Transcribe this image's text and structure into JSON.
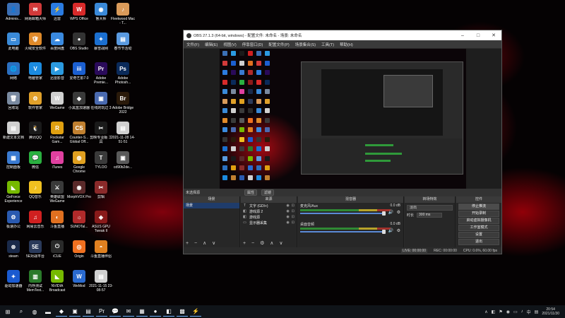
{
  "desktop": {
    "icons": [
      {
        "label": "Adminis...",
        "glyph": "👤",
        "color": "#3b6fb5",
        "col": 0,
        "row": 0
      },
      {
        "label": "网易邮箱大师",
        "glyph": "✉",
        "color": "#d23a3a",
        "col": 1,
        "row": 0
      },
      {
        "label": "迅雷",
        "glyph": "⚡",
        "color": "#2b7be0",
        "col": 2,
        "row": 0
      },
      {
        "label": "WPS Office",
        "glyph": "W",
        "color": "#d82a2a",
        "col": 3,
        "row": 0
      },
      {
        "label": "鲁大师",
        "glyph": "◉",
        "color": "#3a89d8",
        "col": 4,
        "row": 0
      },
      {
        "label": "Fleetwood Mac - T...",
        "glyph": "♪",
        "color": "#d99a5a",
        "col": 5,
        "row": 0
      },
      {
        "label": "此电脑",
        "glyph": "▭",
        "color": "#3a8ad8",
        "col": 0,
        "row": 1
      },
      {
        "label": "火绒安全软件",
        "glyph": "🛡",
        "color": "#e08a2a",
        "col": 1,
        "row": 1
      },
      {
        "label": "百度网盘",
        "glyph": "☁",
        "color": "#3a8ae0",
        "col": 2,
        "row": 1
      },
      {
        "label": "OBS Studio",
        "glyph": "●",
        "color": "#333333",
        "col": 3,
        "row": 1
      },
      {
        "label": "暴雪战网",
        "glyph": "✦",
        "color": "#1b6fd0",
        "col": 4,
        "row": 1
      },
      {
        "label": "春节节活动",
        "glyph": "▤",
        "color": "#5a9ae0",
        "col": 5,
        "row": 1
      },
      {
        "label": "网络",
        "glyph": "🌐",
        "color": "#2b6fc0",
        "col": 0,
        "row": 2
      },
      {
        "label": "电脑管家",
        "glyph": "V",
        "color": "#1b8be0",
        "col": 1,
        "row": 2
      },
      {
        "label": "迅雷影音",
        "glyph": "▶",
        "color": "#2b9ae0",
        "col": 2,
        "row": 2
      },
      {
        "label": "爱奇艺影7.0",
        "glyph": "iii",
        "color": "#1b5fd0",
        "col": 3,
        "row": 2
      },
      {
        "label": "Adobe Premie...",
        "glyph": "Pr",
        "color": "#2a0a5a",
        "col": 4,
        "row": 2
      },
      {
        "label": "Adobe Photosh...",
        "glyph": "Ps",
        "color": "#0a2a5a",
        "col": 5,
        "row": 2
      },
      {
        "label": "回收站",
        "glyph": "🗑",
        "color": "#7a8aa0",
        "col": 0,
        "row": 3
      },
      {
        "label": "软件管家",
        "glyph": "⚙",
        "color": "#e0a02a",
        "col": 1,
        "row": 3
      },
      {
        "label": "WeGame",
        "glyph": "W",
        "color": "#d0d0d0",
        "col": 2,
        "row": 3
      },
      {
        "label": "小黑盒加速器",
        "glyph": "◆",
        "color": "#3a3a3a",
        "col": 3,
        "row": 3
      },
      {
        "label": "在线的玩过 3",
        "glyph": "▣",
        "color": "#4a6ab0",
        "col": 4,
        "row": 3
      },
      {
        "label": "Adobe Bridge 2022",
        "glyph": "Br",
        "color": "#2a1a0a",
        "col": 5,
        "row": 3
      },
      {
        "label": "新建文本文档",
        "glyph": "▤",
        "color": "#d0d0d0",
        "col": 0,
        "row": 4
      },
      {
        "label": "腾讯QQ",
        "glyph": "🐧",
        "color": "#1a1a1a",
        "col": 1,
        "row": 4
      },
      {
        "label": "Rockstar Gam...",
        "glyph": "R",
        "color": "#e0a010",
        "col": 2,
        "row": 4
      },
      {
        "label": "Counter-S... Global Off...",
        "glyph": "CS",
        "color": "#c08030",
        "col": 3,
        "row": 4
      },
      {
        "label": "剪映专业版 工具",
        "glyph": "✂",
        "color": "#1a1a1a",
        "col": 4,
        "row": 4
      },
      {
        "label": "2021-11-28 14-51-51",
        "glyph": "▤",
        "color": "#d0d0d0",
        "col": 5,
        "row": 4
      },
      {
        "label": "控制面板",
        "glyph": "▦",
        "color": "#3a7ad0",
        "col": 0,
        "row": 5
      },
      {
        "label": "微信",
        "glyph": "💬",
        "color": "#2ab040",
        "col": 1,
        "row": 5
      },
      {
        "label": "iTunes",
        "glyph": "♫",
        "color": "#e040a0",
        "col": 2,
        "row": 5
      },
      {
        "label": "Google Chrome",
        "glyph": "◍",
        "color": "#e0a020",
        "col": 3,
        "row": 5
      },
      {
        "label": "TYLOO",
        "glyph": "T",
        "color": "#3a3a3a",
        "col": 4,
        "row": 5
      },
      {
        "label": "cd90b2de...",
        "glyph": "▣",
        "color": "#5a5a5a",
        "col": 5,
        "row": 5
      },
      {
        "label": "GeForce Experience",
        "glyph": "◣",
        "color": "#76b900",
        "col": 0,
        "row": 6
      },
      {
        "label": "QQ音乐",
        "glyph": "♪",
        "color": "#f0c020",
        "col": 1,
        "row": 6
      },
      {
        "label": "英雄联盟WeGame",
        "glyph": "⚔",
        "color": "#3a3a3a",
        "col": 2,
        "row": 6
      },
      {
        "label": "MorphVOX Pro",
        "glyph": "◉",
        "color": "#5a2a2a",
        "col": 3,
        "row": 6
      },
      {
        "label": "剪辑",
        "glyph": "✂",
        "color": "#8a2a2a",
        "col": 4,
        "row": 6
      },
      {
        "label": "极速办公",
        "glyph": "⚙",
        "color": "#2a5ab0",
        "col": 0,
        "row": 7
      },
      {
        "label": "网易云音乐",
        "glyph": "♫",
        "color": "#d02020",
        "col": 1,
        "row": 7
      },
      {
        "label": "斗鱼直播",
        "glyph": "◐",
        "color": "#e07020",
        "col": 2,
        "row": 7
      },
      {
        "label": "SUNOTal...",
        "glyph": "☼",
        "color": "#b02a2a",
        "col": 3,
        "row": 7
      },
      {
        "label": "ASUS GPU Tweak II",
        "glyph": "◈",
        "color": "#8a1a1a",
        "col": 4,
        "row": 7
      },
      {
        "label": "steam",
        "glyph": "⊛",
        "color": "#1a2a4a",
        "col": 0,
        "row": 8
      },
      {
        "label": "5E对战平台",
        "glyph": "5E",
        "color": "#2a3a5a",
        "col": 1,
        "row": 8
      },
      {
        "label": "iCUE",
        "glyph": "⏻",
        "color": "#2a2a2a",
        "col": 2,
        "row": 8
      },
      {
        "label": "Origin",
        "glyph": "◎",
        "color": "#f07020",
        "col": 3,
        "row": 8
      },
      {
        "label": "斗鱼直播伴侣",
        "glyph": "◓",
        "color": "#e08020",
        "col": 4,
        "row": 8
      },
      {
        "label": "驱动加速器",
        "glyph": "✦",
        "color": "#1a5ad0",
        "col": 0,
        "row": 9
      },
      {
        "label": "内存测试 MemTest...",
        "glyph": "▥",
        "color": "#2a7a2a",
        "col": 1,
        "row": 9
      },
      {
        "label": "NVIDIA Broadcast",
        "glyph": "◣",
        "color": "#76b900",
        "col": 2,
        "row": 9
      },
      {
        "label": "WeMod",
        "glyph": "W",
        "color": "#2a6ad0",
        "col": 3,
        "row": 9
      },
      {
        "label": "2021-11-15 23-08-57",
        "glyph": "▤",
        "color": "#d0d0d0",
        "col": 4,
        "row": 9
      }
    ]
  },
  "obs": {
    "title": "OBS 27.1.3 (64-bit, windows) - 配置文件: 未命名 - 场景: 未命名",
    "window_buttons": [
      "–",
      "□",
      "✕"
    ],
    "menu": [
      "文件(F)",
      "编辑(E)",
      "视图(V)",
      "停靠窗口(D)",
      "配置文件(P)",
      "场景集合(S)",
      "工具(T)",
      "帮助(H)"
    ],
    "toolbar": {
      "scene_label": "未选择源",
      "properties": "属性",
      "filters": "滤镜"
    },
    "scenes": {
      "header": "场景",
      "items": [
        "场景"
      ],
      "footer": "+ − ∧ ∨"
    },
    "sources": {
      "header": "来源",
      "items": [
        {
          "icon": "T",
          "name": "文字 (GDI+)"
        },
        {
          "icon": "◧",
          "name": "游戏源 2"
        },
        {
          "icon": "◧",
          "name": "游戏源"
        },
        {
          "icon": "▭",
          "name": "显示器采集"
        }
      ],
      "footer": "+ − ⚙ ∧ ∨"
    },
    "mixer": {
      "header": "混音器",
      "channels": [
        {
          "name": "麦克风/Aux",
          "db": "0.0 dB"
        },
        {
          "name": "桌面音频",
          "db": "0.0 dB"
        }
      ]
    },
    "transitions": {
      "header": "转场特效",
      "type": "淡出",
      "duration_label": "时长",
      "duration": "300 ms"
    },
    "controls": {
      "header": "控件",
      "buttons": [
        "停止推流",
        "开始录制",
        "启动虚拟摄像机",
        "工作室模式",
        "设置",
        "退出"
      ]
    },
    "status": {
      "live": "LIVE: 00:00:00",
      "rec": "REC: 00:00:00",
      "cpu": "CPU: 0.6%, 60.00 fps"
    }
  },
  "taskbar": {
    "items": [
      {
        "glyph": "⊞",
        "name": "start"
      },
      {
        "glyph": "⌕",
        "name": "search"
      },
      {
        "glyph": "◍",
        "name": "edge"
      },
      {
        "glyph": "▬",
        "name": "task-view"
      },
      {
        "glyph": "◆",
        "name": "app-1"
      },
      {
        "glyph": "▣",
        "name": "app-2"
      },
      {
        "glyph": "▤",
        "name": "explorer"
      },
      {
        "glyph": "Pr",
        "name": "premiere"
      },
      {
        "glyph": "💬",
        "name": "wechat"
      },
      {
        "glyph": "✉",
        "name": "mail"
      },
      {
        "glyph": "▦",
        "name": "app-3"
      },
      {
        "glyph": "●",
        "name": "obs"
      },
      {
        "glyph": "◧",
        "name": "app-4"
      },
      {
        "glyph": "▩",
        "name": "app-5"
      },
      {
        "glyph": "⚡",
        "name": "app-6"
      }
    ],
    "clock_time": "20:54",
    "clock_date": "2021/11/30",
    "tray_icons": [
      "∧",
      "◧",
      "⚑",
      "◉",
      "▭",
      "♪",
      "中",
      "▤"
    ]
  }
}
